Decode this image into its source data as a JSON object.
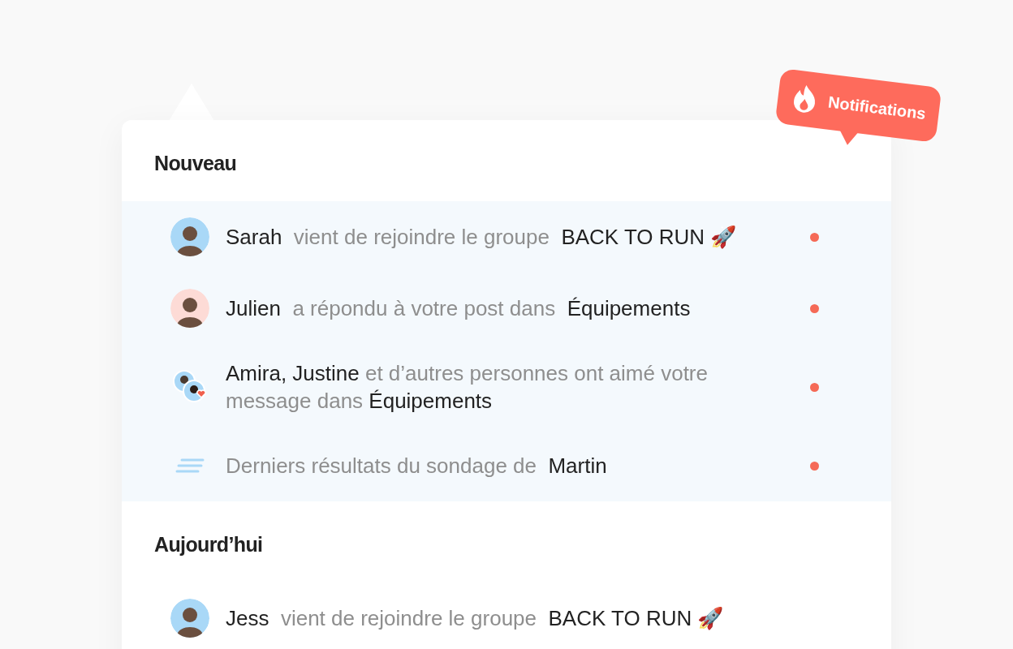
{
  "badge": {
    "label": "Notifications"
  },
  "sections": [
    {
      "title": "Nouveau",
      "items": [
        {
          "kind": "avatar",
          "unread": true,
          "color": "#a9d8f7",
          "text": "**Sarah**  vient de rejoindre le groupe  **BACK TO RUN 🚀**"
        },
        {
          "kind": "avatar",
          "unread": true,
          "color": "#fddbd6",
          "text": "**Julien**  a répondu à votre post dans  **Équipements**"
        },
        {
          "kind": "group",
          "unread": true,
          "text": "**Amira, Justine** et d’autres personnes ont aimé votre message dans **Équipements**"
        },
        {
          "kind": "poll",
          "unread": true,
          "text": "Derniers résultats du sondage de  **Martin**"
        }
      ]
    },
    {
      "title": "Aujourd’hui",
      "items": [
        {
          "kind": "avatar",
          "unread": false,
          "color": "#a9d8f7",
          "text": "**Jess**  vient de rejoindre le groupe  **BACK TO RUN 🚀**"
        }
      ]
    }
  ]
}
